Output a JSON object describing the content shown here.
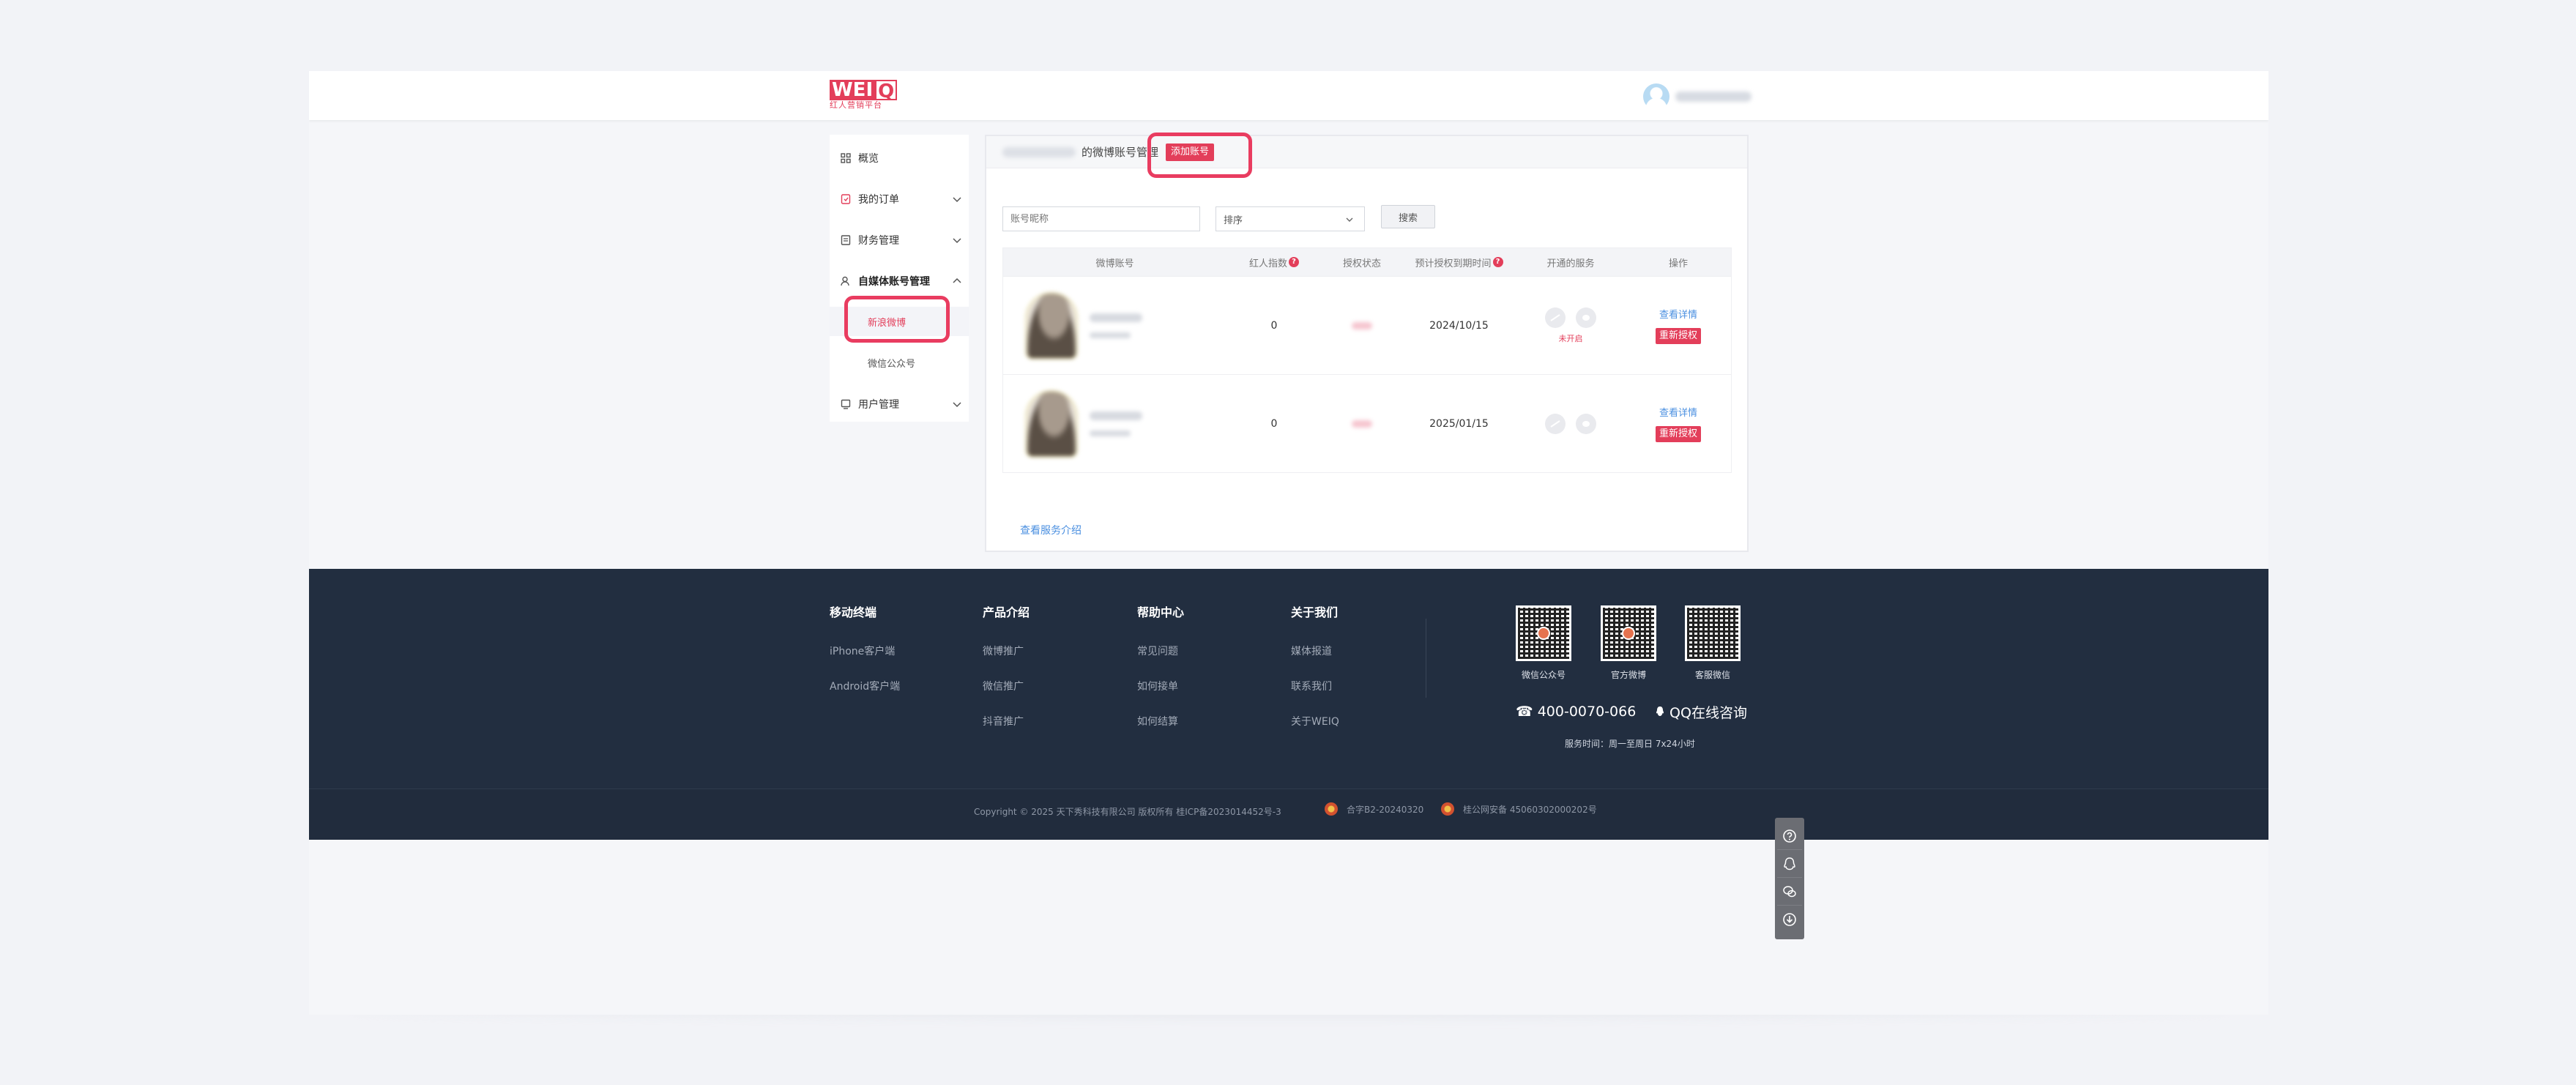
{
  "header": {
    "logo_main": "WEI",
    "logo_q": "Q",
    "logo_sub": "红人营销平台"
  },
  "sidebar": {
    "items": [
      {
        "label": "概览",
        "icon": "grid-icon"
      },
      {
        "label": "我的订单",
        "icon": "order-icon"
      },
      {
        "label": "财务管理",
        "icon": "finance-icon"
      },
      {
        "label": "自媒体账号管理",
        "icon": "account-icon"
      },
      {
        "label": "用户管理",
        "icon": "user-icon"
      }
    ],
    "sub_items": [
      {
        "label": "新浪微博"
      },
      {
        "label": "微信公众号"
      }
    ]
  },
  "main": {
    "title": "的微博账号管理",
    "add_button": "添加账号",
    "search": {
      "placeholder": "账号昵称",
      "sort_label": "排序",
      "button": "搜索"
    },
    "table": {
      "headers": [
        "微博账号",
        "红人指数",
        "授权状态",
        "预计授权到期时间",
        "开通的服务",
        "操作"
      ],
      "rows": [
        {
          "index": "0",
          "expiry": "2024/10/15",
          "service_note": "未开启",
          "detail": "查看详情",
          "reauth": "重新授权"
        },
        {
          "index": "0",
          "expiry": "2025/01/15",
          "service_note": "",
          "detail": "查看详情",
          "reauth": "重新授权"
        }
      ]
    },
    "service_link": "查看服务介绍"
  },
  "footer": {
    "columns": [
      {
        "title": "移动终端",
        "links": [
          "iPhone客户端",
          "Android客户端"
        ]
      },
      {
        "title": "产品介绍",
        "links": [
          "微博推广",
          "微信推广",
          "抖音推广"
        ]
      },
      {
        "title": "帮助中心",
        "links": [
          "常见问题",
          "如何接单",
          "如何结算"
        ]
      },
      {
        "title": "关于我们",
        "links": [
          "媒体报道",
          "联系我们",
          "关于WEIQ"
        ]
      }
    ],
    "qrcodes": [
      "微信公众号",
      "官方微博",
      "客服微信"
    ],
    "phone": "☎ 400-0070-066",
    "qq": "QQ在线咨询",
    "hours": "服务时间：周一至周日 7x24小时",
    "copyright": "Copyright © 2025 天下秀科技有限公司 版权所有 桂ICP备2023014452号-3",
    "license1": "合字B2-20240320",
    "license2": "桂公网安备 45060302000202号"
  },
  "colors": {
    "accent": "#e33e5a",
    "footer_bg": "#222e40",
    "link": "#4a8fe0"
  }
}
